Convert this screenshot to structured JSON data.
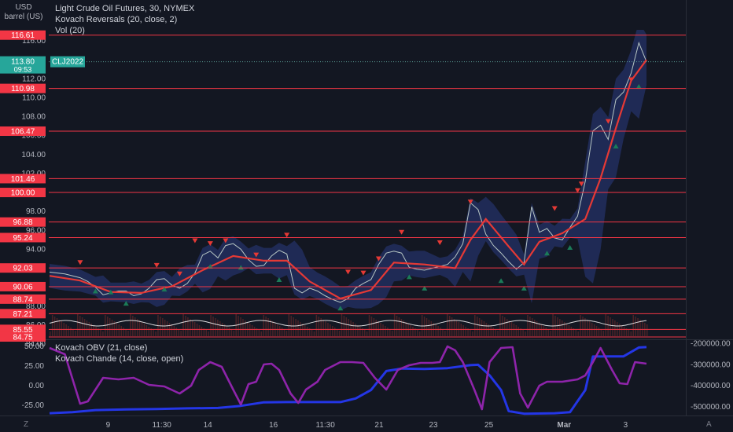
{
  "header": {
    "currency": "USD",
    "unit": "barrel (US)"
  },
  "main_legend": {
    "line1": "Light Crude Oil Futures, 30, NYMEX",
    "line2": "Kovach Reversals (20, close, 2)",
    "line3": "Vol (20)"
  },
  "lower_legend": {
    "line1": "Kovach OBV (21, close)",
    "line2": "Kovach Chande (14, close, open)"
  },
  "price_tag": {
    "price": "113.80",
    "symbol": "CLJ2022",
    "countdown": "09:53",
    "color": "#26a69a"
  },
  "axis_corner": {
    "left": "Z",
    "right": "A"
  },
  "colors": {
    "background": "#131722",
    "level": "#f23645",
    "smooth": "#e53935",
    "band": "#2a3a80",
    "obv": "#2436e6",
    "chande": "#8e24aa",
    "up_marker": "#1b7b58",
    "down_marker": "#e53935",
    "volume_osc": "#ffffff"
  },
  "chart_data": [
    {
      "type": "line",
      "title": "Light Crude Oil Futures, 30, NYMEX",
      "ylim": [
        84.5,
        117.0
      ],
      "x_labels": [
        "9",
        "11:30",
        "14",
        "16",
        "11:30",
        "21",
        "23",
        "25",
        "Mar",
        "3"
      ],
      "y_ticks": [
        "116.00",
        "114.00",
        "112.00",
        "110.00",
        "108.00",
        "106.00",
        "104.00",
        "102.00",
        "100.00",
        "98.00",
        "96.00",
        "94.00",
        "92.00",
        "90.00",
        "88.00",
        "86.00",
        "84.00"
      ],
      "levels": [
        {
          "label": "116.61",
          "value": 116.61
        },
        {
          "label": "110.98",
          "value": 110.98
        },
        {
          "label": "106.47",
          "value": 106.47
        },
        {
          "label": "101.46",
          "value": 101.46
        },
        {
          "label": "100.00",
          "value": 100.0
        },
        {
          "label": "96.88",
          "value": 96.88
        },
        {
          "label": "95.24",
          "value": 95.24
        },
        {
          "label": "92.03",
          "value": 92.03
        },
        {
          "label": "90.06",
          "value": 90.06
        },
        {
          "label": "88.74",
          "value": 88.74
        },
        {
          "label": "87.21",
          "value": 87.21
        },
        {
          "label": "85.55",
          "value": 85.55
        },
        {
          "label": "84.75",
          "value": 84.75
        }
      ],
      "price_series": [
        [
          0,
          91.6
        ],
        [
          20,
          91.4
        ],
        [
          40,
          91.0
        ],
        [
          50,
          90.6
        ],
        [
          60,
          90.0
        ],
        [
          70,
          89.2
        ],
        [
          80,
          89.4
        ],
        [
          90,
          89.6
        ],
        [
          100,
          89.6
        ],
        [
          110,
          89.1
        ],
        [
          120,
          89.3
        ],
        [
          130,
          89.9
        ],
        [
          140,
          90.8
        ],
        [
          150,
          90.9
        ],
        [
          160,
          90.2
        ],
        [
          170,
          89.9
        ],
        [
          180,
          90.4
        ],
        [
          190,
          91.5
        ],
        [
          200,
          93.4
        ],
        [
          210,
          93.8
        ],
        [
          220,
          93.1
        ],
        [
          230,
          94.4
        ],
        [
          240,
          94.6
        ],
        [
          250,
          94.0
        ],
        [
          260,
          92.9
        ],
        [
          270,
          92.2
        ],
        [
          280,
          92.3
        ],
        [
          290,
          93.3
        ],
        [
          300,
          93.9
        ],
        [
          310,
          93.5
        ],
        [
          320,
          89.9
        ],
        [
          330,
          89.4
        ],
        [
          340,
          89.9
        ],
        [
          350,
          89.6
        ],
        [
          360,
          89.1
        ],
        [
          370,
          88.7
        ],
        [
          380,
          88.4
        ],
        [
          390,
          88.8
        ],
        [
          400,
          89.9
        ],
        [
          410,
          90.4
        ],
        [
          420,
          90.8
        ],
        [
          430,
          92.4
        ],
        [
          440,
          93.6
        ],
        [
          450,
          93.8
        ],
        [
          460,
          93.6
        ],
        [
          470,
          92.1
        ],
        [
          480,
          91.9
        ],
        [
          490,
          91.8
        ],
        [
          500,
          92.0
        ],
        [
          510,
          92.2
        ],
        [
          520,
          92.4
        ],
        [
          530,
          93.2
        ],
        [
          540,
          94.6
        ],
        [
          550,
          98.9
        ],
        [
          560,
          98.2
        ],
        [
          570,
          95.6
        ],
        [
          580,
          94.4
        ],
        [
          590,
          93.6
        ],
        [
          600,
          92.7
        ],
        [
          610,
          91.9
        ],
        [
          620,
          92.6
        ],
        [
          630,
          98.5
        ],
        [
          640,
          95.8
        ],
        [
          650,
          96.2
        ],
        [
          660,
          95.2
        ],
        [
          670,
          95.0
        ],
        [
          680,
          96.3
        ],
        [
          690,
          97.5
        ],
        [
          700,
          101.2
        ],
        [
          710,
          106.5
        ],
        [
          720,
          107.1
        ],
        [
          730,
          105.6
        ],
        [
          740,
          109.8
        ],
        [
          750,
          110.6
        ],
        [
          760,
          112.6
        ],
        [
          770,
          115.8
        ],
        [
          780,
          113.8
        ]
      ],
      "smoothed_series": [
        [
          0,
          91.2
        ],
        [
          40,
          90.7
        ],
        [
          80,
          89.5
        ],
        [
          120,
          89.4
        ],
        [
          160,
          90.1
        ],
        [
          200,
          91.8
        ],
        [
          240,
          93.3
        ],
        [
          280,
          92.8
        ],
        [
          310,
          92.8
        ],
        [
          340,
          90.6
        ],
        [
          380,
          88.8
        ],
        [
          420,
          89.7
        ],
        [
          450,
          92.6
        ],
        [
          490,
          92.4
        ],
        [
          530,
          92.0
        ],
        [
          550,
          95.0
        ],
        [
          570,
          97.2
        ],
        [
          600,
          94.3
        ],
        [
          620,
          92.4
        ],
        [
          640,
          94.8
        ],
        [
          670,
          95.7
        ],
        [
          700,
          97.2
        ],
        [
          720,
          101.5
        ],
        [
          740,
          106.8
        ],
        [
          760,
          111.8
        ],
        [
          780,
          114.0
        ]
      ],
      "reversal_down_markers": [
        [
          40,
          92.6
        ],
        [
          140,
          92.3
        ],
        [
          170,
          91.4
        ],
        [
          190,
          94.9
        ],
        [
          210,
          94.6
        ],
        [
          230,
          94.9
        ],
        [
          270,
          93.4
        ],
        [
          310,
          95.5
        ],
        [
          390,
          91.6
        ],
        [
          410,
          91.5
        ],
        [
          430,
          93.0
        ],
        [
          460,
          95.8
        ],
        [
          510,
          94.7
        ],
        [
          550,
          99.0
        ],
        [
          660,
          98.3
        ],
        [
          690,
          100.2
        ],
        [
          695,
          100.9
        ],
        [
          730,
          107.5
        ],
        [
          760,
          111.9
        ]
      ],
      "reversal_up_markers": [
        [
          60,
          89.6
        ],
        [
          80,
          89.5
        ],
        [
          100,
          88.3
        ],
        [
          150,
          89.8
        ],
        [
          210,
          92.2
        ],
        [
          250,
          92.1
        ],
        [
          300,
          90.8
        ],
        [
          380,
          87.8
        ],
        [
          470,
          91.1
        ],
        [
          490,
          89.9
        ],
        [
          590,
          90.7
        ],
        [
          620,
          89.9
        ],
        [
          650,
          93.6
        ],
        [
          680,
          94.2
        ],
        [
          740,
          104.9
        ],
        [
          770,
          111.2
        ]
      ]
    },
    {
      "type": "line",
      "title": "Kovach OBV (21, close) / Kovach Chande (14, close, open)",
      "left_axis": {
        "ylim": [
          -37,
          58
        ],
        "ticks": [
          "50.00",
          "25.00",
          "0.00",
          "-25.00"
        ]
      },
      "right_axis": {
        "ylim": [
          -537000,
          -183000
        ],
        "ticks": [
          "-200000.00",
          "-300000.00",
          "-400000.00",
          "-500000.00"
        ]
      },
      "series": [
        {
          "name": "Kovach OBV (21, close)",
          "axis": "right",
          "points": [
            [
              0,
              -530000
            ],
            [
              30,
              -525000
            ],
            [
              60,
              -515000
            ],
            [
              100,
              -512000
            ],
            [
              140,
              -510000
            ],
            [
              180,
              -507000
            ],
            [
              220,
              -505000
            ],
            [
              250,
              -495000
            ],
            [
              280,
              -478000
            ],
            [
              310,
              -477000
            ],
            [
              340,
              -477000
            ],
            [
              380,
              -477000
            ],
            [
              400,
              -460000
            ],
            [
              420,
              -420000
            ],
            [
              440,
              -330000
            ],
            [
              460,
              -318000
            ],
            [
              490,
              -320000
            ],
            [
              520,
              -316000
            ],
            [
              550,
              -302000
            ],
            [
              560,
              -300000
            ],
            [
              575,
              -350000
            ],
            [
              590,
              -420000
            ],
            [
              600,
              -520000
            ],
            [
              620,
              -532000
            ],
            [
              660,
              -530000
            ],
            [
              680,
              -525000
            ],
            [
              700,
              -420000
            ],
            [
              710,
              -261000
            ],
            [
              730,
              -260000
            ],
            [
              750,
              -260000
            ],
            [
              770,
              -218000
            ],
            [
              780,
              -216000
            ]
          ]
        },
        {
          "name": "Kovach Chande (14, close, open)",
          "axis": "left",
          "points": [
            [
              0,
              48
            ],
            [
              20,
              40
            ],
            [
              40,
              -23
            ],
            [
              50,
              -20
            ],
            [
              70,
              10
            ],
            [
              90,
              8
            ],
            [
              110,
              10
            ],
            [
              130,
              1
            ],
            [
              150,
              -1
            ],
            [
              170,
              -10
            ],
            [
              185,
              0
            ],
            [
              195,
              20
            ],
            [
              210,
              30
            ],
            [
              225,
              24
            ],
            [
              240,
              -5
            ],
            [
              250,
              -24
            ],
            [
              260,
              2
            ],
            [
              270,
              5
            ],
            [
              280,
              27
            ],
            [
              290,
              28
            ],
            [
              300,
              20
            ],
            [
              315,
              -10
            ],
            [
              325,
              -22
            ],
            [
              335,
              -5
            ],
            [
              350,
              5
            ],
            [
              360,
              20
            ],
            [
              380,
              30
            ],
            [
              395,
              30
            ],
            [
              410,
              29
            ],
            [
              425,
              10
            ],
            [
              440,
              -5
            ],
            [
              455,
              20
            ],
            [
              470,
              26
            ],
            [
              485,
              29
            ],
            [
              500,
              29
            ],
            [
              510,
              30
            ],
            [
              520,
              50
            ],
            [
              530,
              45
            ],
            [
              540,
              30
            ],
            [
              555,
              -5
            ],
            [
              565,
              -30
            ],
            [
              575,
              30
            ],
            [
              590,
              48
            ],
            [
              605,
              49
            ],
            [
              615,
              -10
            ],
            [
              625,
              -28
            ],
            [
              640,
              0
            ],
            [
              650,
              5
            ],
            [
              670,
              5
            ],
            [
              690,
              8
            ],
            [
              700,
              13
            ],
            [
              710,
              30
            ],
            [
              720,
              48
            ],
            [
              735,
              20
            ],
            [
              745,
              3
            ],
            [
              755,
              2
            ],
            [
              765,
              30
            ],
            [
              780,
              28
            ]
          ]
        }
      ]
    }
  ]
}
